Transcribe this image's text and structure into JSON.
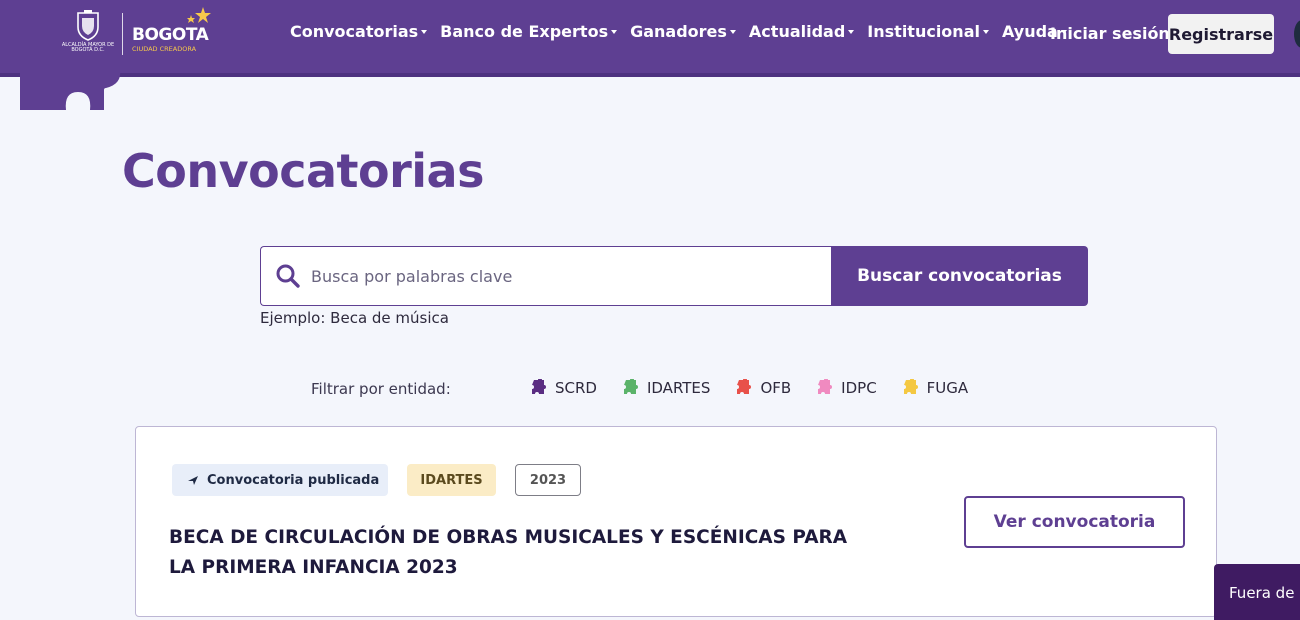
{
  "header": {
    "logo": {
      "seal_text": "ALCALDÍA MAYOR DE BOGOTÁ D.C.",
      "brand_word": "BOGOTA",
      "brand_sub": "CIUDAD CREADORA"
    },
    "nav": [
      {
        "label": "Convocatorias"
      },
      {
        "label": "Banco de Expertos"
      },
      {
        "label": "Ganadores"
      },
      {
        "label": "Actualidad"
      },
      {
        "label": "Institucional"
      },
      {
        "label": "Ayuda"
      }
    ],
    "login_label": "Iniciar sesión",
    "register_label": "Registrarse"
  },
  "main": {
    "title": "Convocatorias",
    "search": {
      "placeholder": "Busca por palabras clave",
      "value": "",
      "button_label": "Buscar convocatorias",
      "example": "Ejemplo: Beca de música"
    },
    "filters": {
      "label": "Filtrar por entidad:",
      "items": [
        {
          "label": "SCRD",
          "color": "#5a2d82"
        },
        {
          "label": "IDARTES",
          "color": "#5bb36a"
        },
        {
          "label": "OFB",
          "color": "#e8514a"
        },
        {
          "label": "IDPC",
          "color": "#f08ac0"
        },
        {
          "label": "FUGA",
          "color": "#f4c842"
        }
      ]
    },
    "card": {
      "status": "Convocatoria publicada",
      "entity": "IDARTES",
      "year": "2023",
      "title": "BECA DE CIRCULACIÓN DE OBRAS MUSICALES Y ESCÉNICAS PARA LA PRIMERA INFANCIA 2023",
      "button_label": "Ver convocatoria"
    },
    "outside_tab_label": "Fuera de l"
  },
  "colors": {
    "primary": "#5e3f92",
    "background": "#f4f6fc",
    "status_badge_bg": "#e8eef9",
    "entity_badge_bg": "#fbecc6"
  }
}
